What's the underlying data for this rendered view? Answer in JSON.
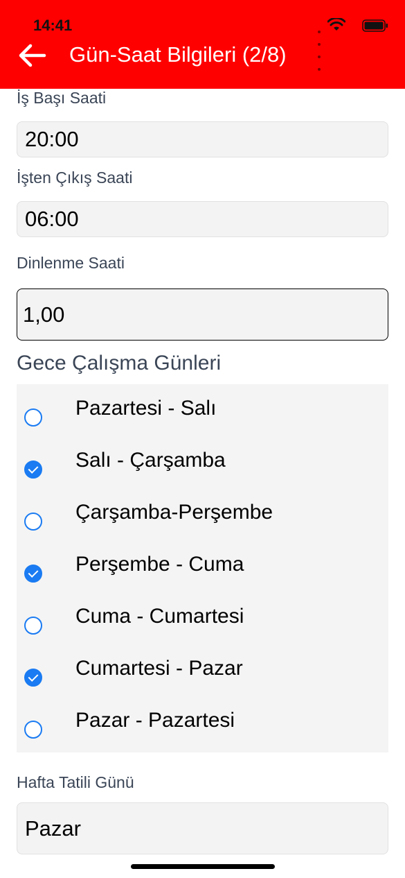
{
  "status_bar": {
    "time": "14:41"
  },
  "header": {
    "title": "Gün-Saat Bilgileri (2/8)"
  },
  "colors": {
    "header_bg": "#ff0000",
    "radio_accent": "#1a7bf2"
  },
  "fields": {
    "start_time": {
      "label": "İş Başı Saati",
      "value": "20:00"
    },
    "end_time": {
      "label": "İşten Çıkış Saati",
      "value": "06:00"
    },
    "rest_time": {
      "label": "Dinlenme Saati",
      "value": "1,00"
    }
  },
  "night_days": {
    "title": "Gece Çalışma Günleri",
    "items": [
      {
        "label": "Pazartesi - Salı",
        "checked": false
      },
      {
        "label": "Salı - Çarşamba",
        "checked": true
      },
      {
        "label": "Çarşamba-Perşembe",
        "checked": false
      },
      {
        "label": "Perşembe - Cuma",
        "checked": true
      },
      {
        "label": "Cuma - Cumartesi",
        "checked": false
      },
      {
        "label": "Cumartesi - Pazar",
        "checked": true
      },
      {
        "label": "Pazar - Pazartesi",
        "checked": false
      }
    ]
  },
  "weekend": {
    "label": "Hafta Tatili Günü",
    "value": "Pazar"
  }
}
